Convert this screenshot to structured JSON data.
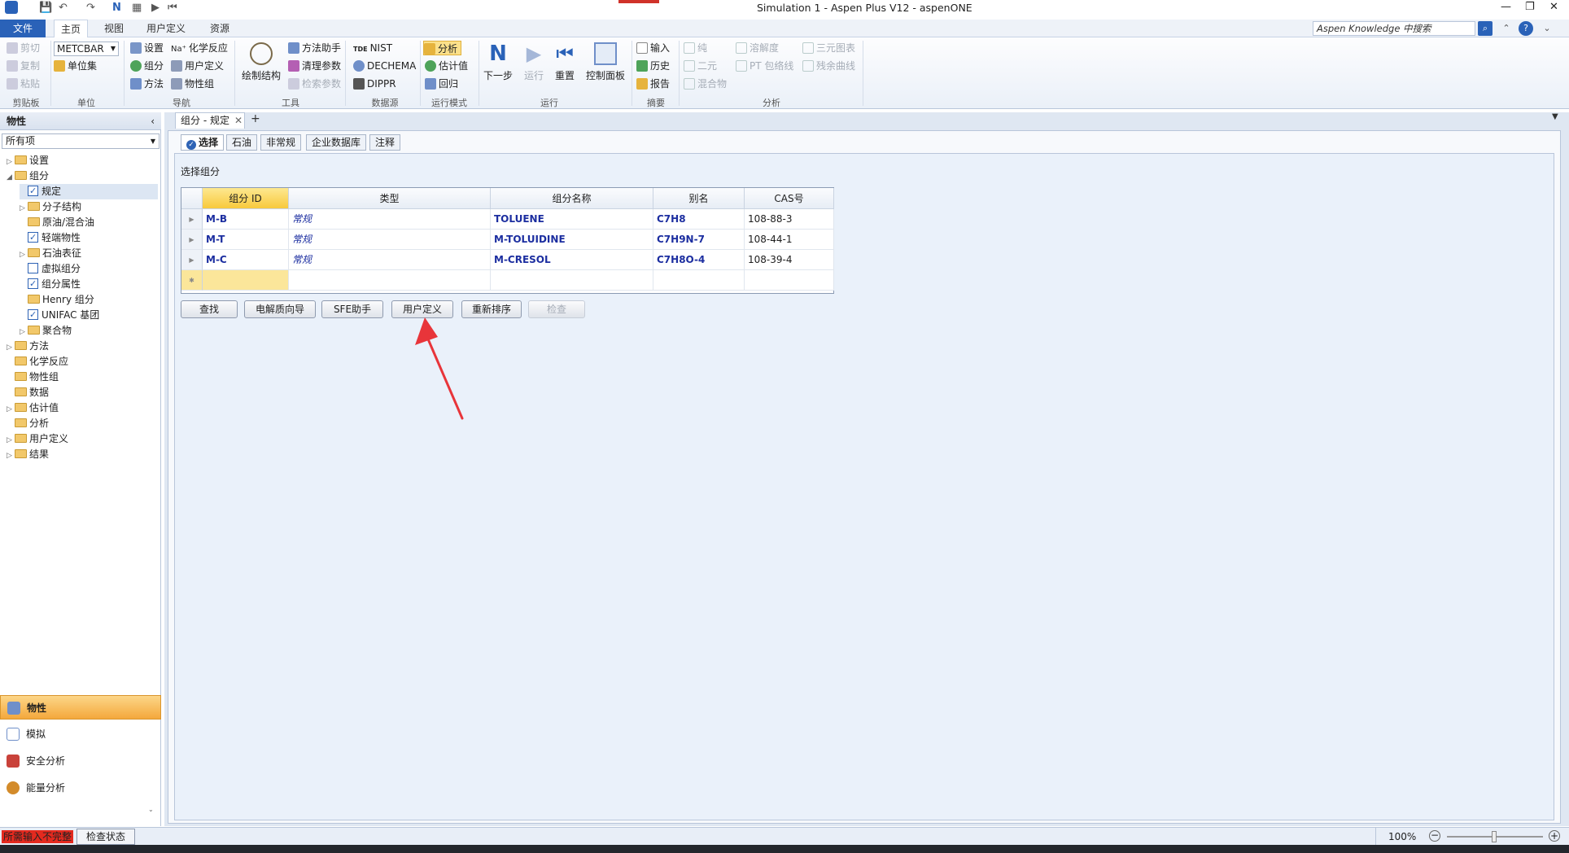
{
  "window": {
    "title": "Simulation 1 - Aspen Plus V12 - aspenONE"
  },
  "menu": {
    "file": "文件",
    "tabs": [
      "主页",
      "视图",
      "用户定义",
      "资源"
    ]
  },
  "search": {
    "placeholder": "Aspen Knowledge 中搜索"
  },
  "ribbon": {
    "clipboard": {
      "cut": "剪切",
      "copy": "复制",
      "paste": "粘贴",
      "group": "剪贴板"
    },
    "units": {
      "unit_set": "METCBAR",
      "unit_sets": "单位集",
      "group": "单位"
    },
    "nav": {
      "setup": "设置",
      "components": "组分",
      "methods": "方法",
      "chem": "化学反应",
      "custom": "用户定义",
      "propsets": "物性组",
      "group": "导航"
    },
    "tools": {
      "draw": "绘制结构",
      "method_asst": "方法助手",
      "clean_params": "清理参数",
      "retrieve_params": "检索参数",
      "group": "工具"
    },
    "datasrc": {
      "nist": "NIST",
      "dechema": "DECHEMA",
      "dippr": "DIPPR",
      "group": "数据源"
    },
    "runmode": {
      "analysis": "分析",
      "estimation": "估计值",
      "regression": "回归",
      "group": "运行模式"
    },
    "run": {
      "next": "下一步",
      "run": "运行",
      "reset": "重置",
      "control": "控制面板",
      "group": "运行"
    },
    "summary": {
      "input": "输入",
      "history": "历史",
      "report": "报告",
      "group": "摘要"
    },
    "analysis": {
      "pure": "纯",
      "binary": "二元",
      "mixture": "混合物",
      "solubility": "溶解度",
      "pt_env": "PT 包络线",
      "ternary": "三元图表",
      "residue": "残余曲线",
      "group": "分析"
    }
  },
  "leftpane": {
    "header": "物性",
    "filter": "所有项",
    "tree": [
      {
        "label": "设置"
      },
      {
        "label": "组分"
      },
      {
        "label": "规定"
      },
      {
        "label": "分子结构"
      },
      {
        "label": "原油/混合油"
      },
      {
        "label": "轻端物性"
      },
      {
        "label": "石油表征"
      },
      {
        "label": "虚拟组分"
      },
      {
        "label": "组分属性"
      },
      {
        "label": "Henry 组分"
      },
      {
        "label": "UNIFAC 基团"
      },
      {
        "label": "聚合物"
      },
      {
        "label": "方法"
      },
      {
        "label": "化学反应"
      },
      {
        "label": "物性组"
      },
      {
        "label": "数据"
      },
      {
        "label": "估计值"
      },
      {
        "label": "分析"
      },
      {
        "label": "用户定义"
      },
      {
        "label": "结果"
      }
    ],
    "nav": [
      "物性",
      "模拟",
      "安全分析",
      "能量分析"
    ]
  },
  "doc": {
    "tab_title": "组分 - 规定",
    "form_tabs": [
      "选择",
      "石油",
      "非常规",
      "企业数据库",
      "注释"
    ],
    "section_label": "选择组分",
    "columns": [
      "组分 ID",
      "类型",
      "组分名称",
      "别名",
      "CAS号"
    ],
    "rows": [
      {
        "id": "M-B",
        "type": "常规",
        "name": "TOLUENE",
        "alias": "C7H8",
        "cas": "108-88-3"
      },
      {
        "id": "M-T",
        "type": "常规",
        "name": "M-TOLUIDINE",
        "alias": "C7H9N-7",
        "cas": "108-44-1"
      },
      {
        "id": "M-C",
        "type": "常规",
        "name": "M-CRESOL",
        "alias": "C7H8O-4",
        "cas": "108-39-4"
      }
    ],
    "buttons": [
      "查找",
      "电解质向导",
      "SFE助手",
      "用户定义",
      "重新排序",
      "检查"
    ]
  },
  "status": {
    "warning": "所需输入不完整",
    "check": "检查状态",
    "zoom": "100%"
  },
  "colors": {
    "accent": "#2a62b8",
    "annotation_arrow": "#e8353a",
    "warning": "#e42a1f"
  }
}
